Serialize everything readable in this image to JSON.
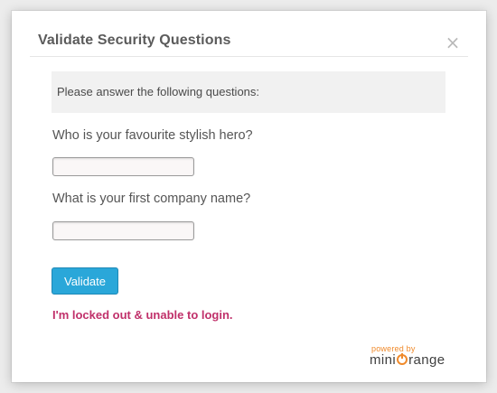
{
  "dialog": {
    "title": "Validate Security Questions",
    "close_symbol": "×",
    "instruction": "Please answer the following questions:"
  },
  "questions": [
    {
      "label": "Who is your favourite stylish hero?",
      "value": "",
      "placeholder": ""
    },
    {
      "label": "What is your first company name?",
      "value": "",
      "placeholder": ""
    }
  ],
  "actions": {
    "validate_label": "Validate",
    "locked_out_label": "I'm locked out & unable to login."
  },
  "branding": {
    "powered_by": "powered by",
    "brand_prefix": "mini",
    "brand_suffix": "range",
    "brand_color": "#f08a2b"
  },
  "colors": {
    "accent": "#2aa7d9",
    "link": "#c0306a"
  },
  "icons": {
    "close": "close-icon",
    "brand_logo": "miniorange-logo-icon"
  }
}
